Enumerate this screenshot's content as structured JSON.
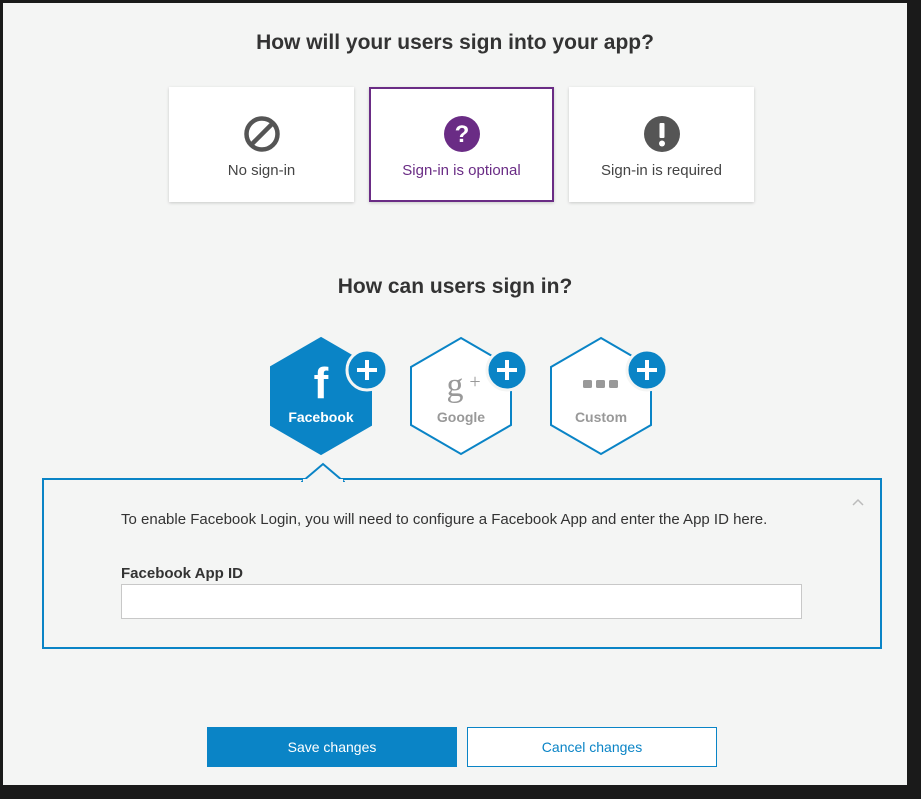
{
  "signin_question": "How will your users sign into your app?",
  "signin_options": [
    {
      "label": "No sign-in",
      "icon": "no-entry-icon",
      "selected": false
    },
    {
      "label": "Sign-in is optional",
      "icon": "question-icon",
      "selected": true
    },
    {
      "label": "Sign-in is required",
      "icon": "exclamation-icon",
      "selected": false
    }
  ],
  "providers_question": "How can users sign in?",
  "providers": [
    {
      "label": "Facebook",
      "icon": "facebook-icon",
      "active": true
    },
    {
      "label": "Google",
      "icon": "google-plus-icon",
      "active": false
    },
    {
      "label": "Custom",
      "icon": "ellipsis-icon",
      "active": false
    }
  ],
  "facebook_panel": {
    "help_text": "To enable Facebook Login, you will need to configure a Facebook App and enter the App ID here.",
    "field_label": "Facebook App ID",
    "field_value": "",
    "field_placeholder": ""
  },
  "actions": {
    "save_label": "Save changes",
    "cancel_label": "Cancel changes"
  },
  "colors": {
    "accent": "#0a84c6",
    "selected": "#6a2c85",
    "icon_gray": "#555555",
    "background": "#f4f5f4"
  }
}
